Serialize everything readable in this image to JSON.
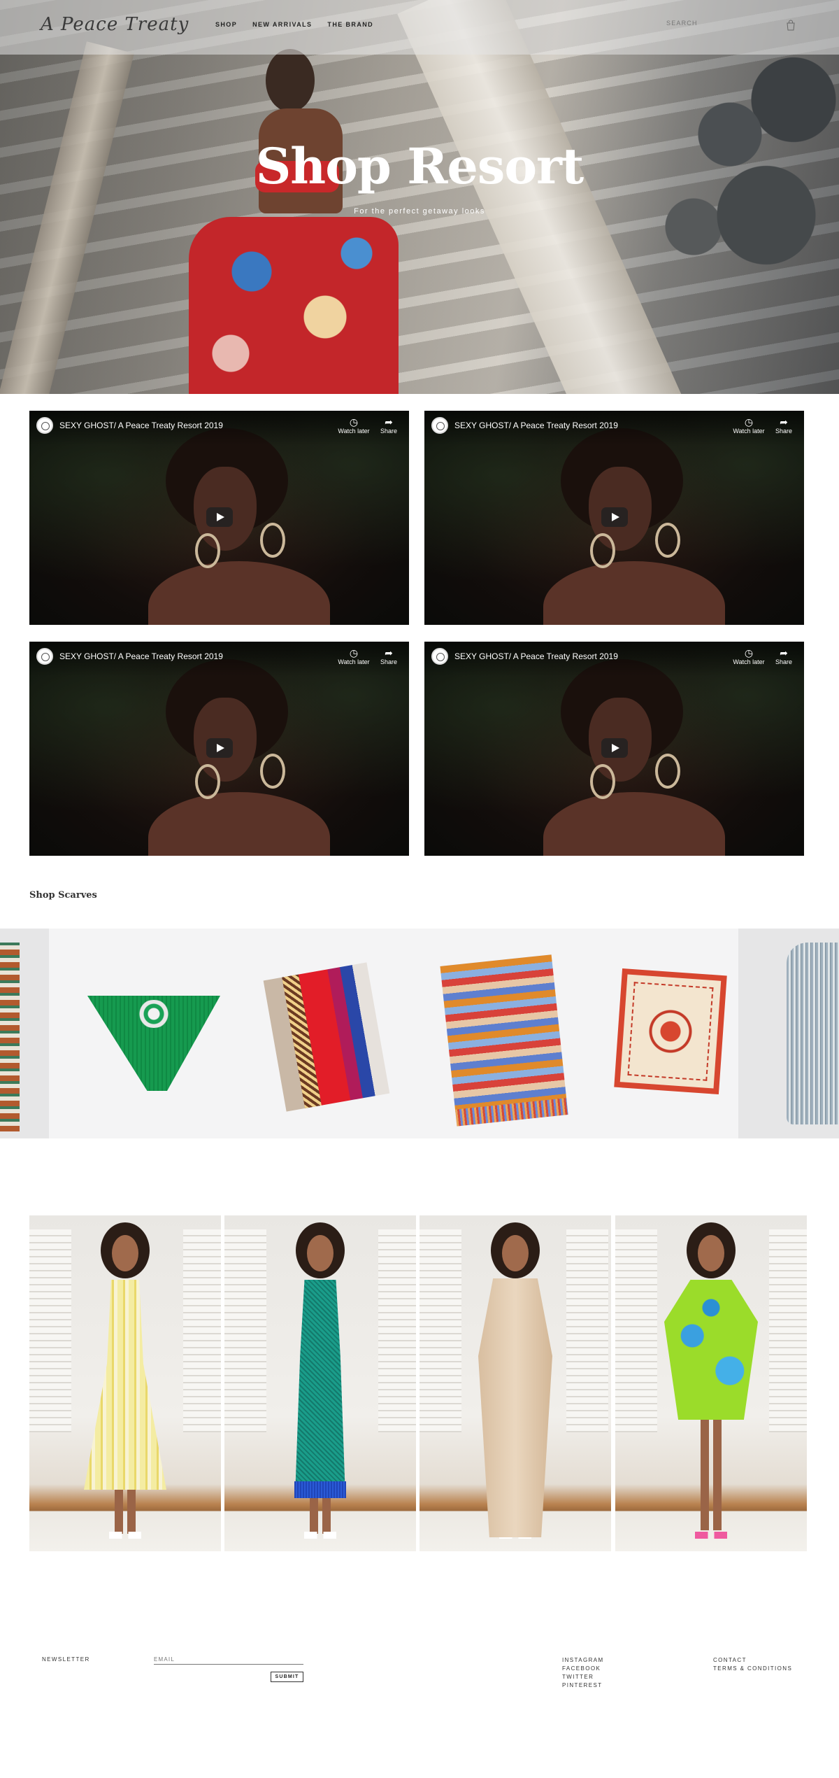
{
  "header": {
    "logo": "A Peace Treaty",
    "nav": [
      "SHOP",
      "NEW ARRIVALS",
      "THE BRAND"
    ],
    "search_placeholder": "SEARCH",
    "cart_icon": "shopping-bag-icon"
  },
  "hero": {
    "title": "Shop Resort",
    "subtitle": "For the perfect getaway looks"
  },
  "videos": [
    {
      "title": "SEXY GHOST/ A Peace Treaty Resort 2019",
      "watch_later": "Watch later",
      "share": "Share"
    },
    {
      "title": "SEXY GHOST/ A Peace Treaty Resort 2019",
      "watch_later": "Watch later",
      "share": "Share"
    },
    {
      "title": "SEXY GHOST/ A Peace Treaty Resort 2019",
      "watch_later": "Watch later",
      "share": "Share"
    },
    {
      "title": "SEXY GHOST/ A Peace Treaty Resort 2019",
      "watch_later": "Watch later",
      "share": "Share"
    }
  ],
  "scarves": {
    "title": "Shop Scarves"
  },
  "footer": {
    "newsletter_label": "NEWSLETTER",
    "email_placeholder": "EMAIL",
    "submit_label": "SUBMIT",
    "social": [
      "INSTAGRAM",
      "FACEBOOK",
      "TWITTER",
      "PINTEREST"
    ],
    "info": [
      "CONTACT",
      "TERMS & CONDITIONS"
    ]
  },
  "colors": {
    "header_bg": "#e6e6e6",
    "carousel_bg": "#eeeeef",
    "text": "#222222"
  }
}
